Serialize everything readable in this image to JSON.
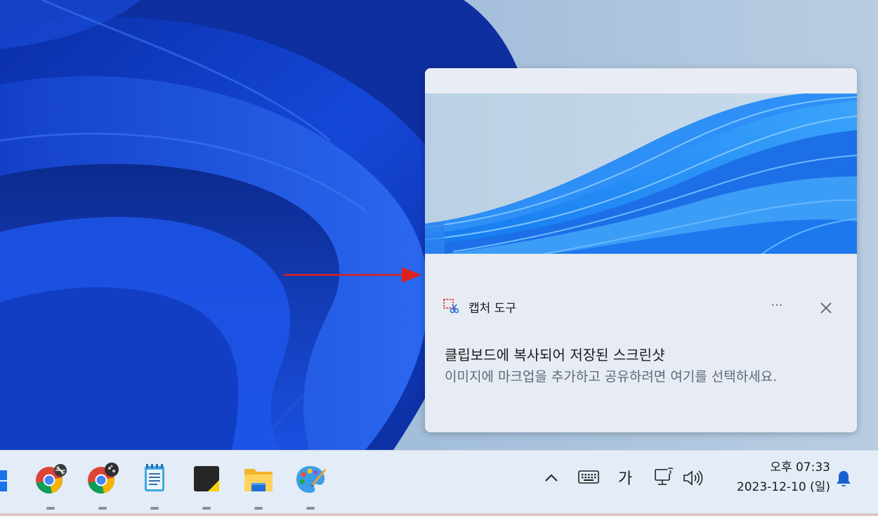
{
  "notification": {
    "app_name": "캡처 도구",
    "more_label": "···",
    "title": "클립보드에 복사되어 저장된 스크린샷",
    "body": "이미지에 마크업을 추가하고 공유하려면 여기를 선택하세요."
  },
  "taskbar": {
    "apps": [
      {
        "icon": "start-icon"
      },
      {
        "icon": "chrome-icon"
      },
      {
        "icon": "chrome-icon"
      },
      {
        "icon": "notepad-icon"
      },
      {
        "icon": "sticky-notes-icon"
      },
      {
        "icon": "file-explorer-icon"
      },
      {
        "icon": "paint-icon"
      }
    ],
    "tray": {
      "show_hidden_icon": "chevron-up-icon",
      "keyboard_icon": "touch-keyboard-icon",
      "ime_label": "가",
      "network_icon": "network-icon",
      "volume_icon": "volume-icon",
      "notification_icon": "bell-icon"
    },
    "clock": {
      "time": "오후 07:33",
      "date": "2023-12-10 (일)"
    }
  },
  "colors": {
    "wallpaper_bg": "#a9c3dc",
    "wallpaper_blue": "#0f3fc4",
    "taskbar_bg": "#e3ecf7",
    "toast_bg": "#e6ebf4",
    "annotation_red": "#e0201c",
    "bell_blue": "#1a5fd1"
  }
}
